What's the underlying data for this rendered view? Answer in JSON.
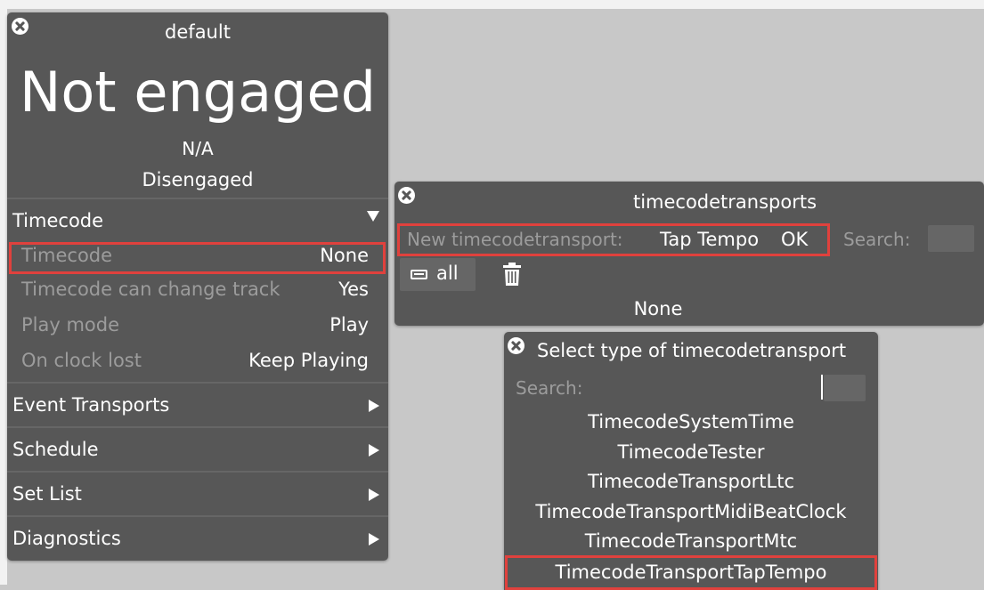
{
  "engine_panel": {
    "title": "default",
    "state": "Not engaged",
    "position": "N/A",
    "engagement": "Disengaged",
    "timecode_section": {
      "label": "Timecode",
      "rows": [
        {
          "key": "Timecode",
          "value": "None"
        },
        {
          "key": "Timecode can change track",
          "value": "Yes"
        },
        {
          "key": "Play mode",
          "value": "Play"
        },
        {
          "key": "On clock lost",
          "value": "Keep Playing"
        }
      ]
    },
    "sections": [
      "Event Transports",
      "Schedule",
      "Set List",
      "Diagnostics"
    ]
  },
  "transports_panel": {
    "title": "timecodetransports",
    "new_label": "New timecodetransport:",
    "new_type": "Tap Tempo",
    "ok_label": "OK",
    "search_label": "Search:",
    "filter_label": "all",
    "empty_text": "None"
  },
  "type_select_panel": {
    "title": "Select type of timecodetransport",
    "search_label": "Search:",
    "options": [
      "TimecodeSystemTime",
      "TimecodeTester",
      "TimecodeTransportLtc",
      "TimecodeTransportMidiBeatClock",
      "TimecodeTransportMtc",
      "TimecodeTransportTapTempo"
    ],
    "highlighted_option_index": 5
  },
  "colors": {
    "background": "#c8c8c8",
    "panel": "#575757",
    "highlight": "#e0413d",
    "dim_text": "#9c9c9c"
  }
}
